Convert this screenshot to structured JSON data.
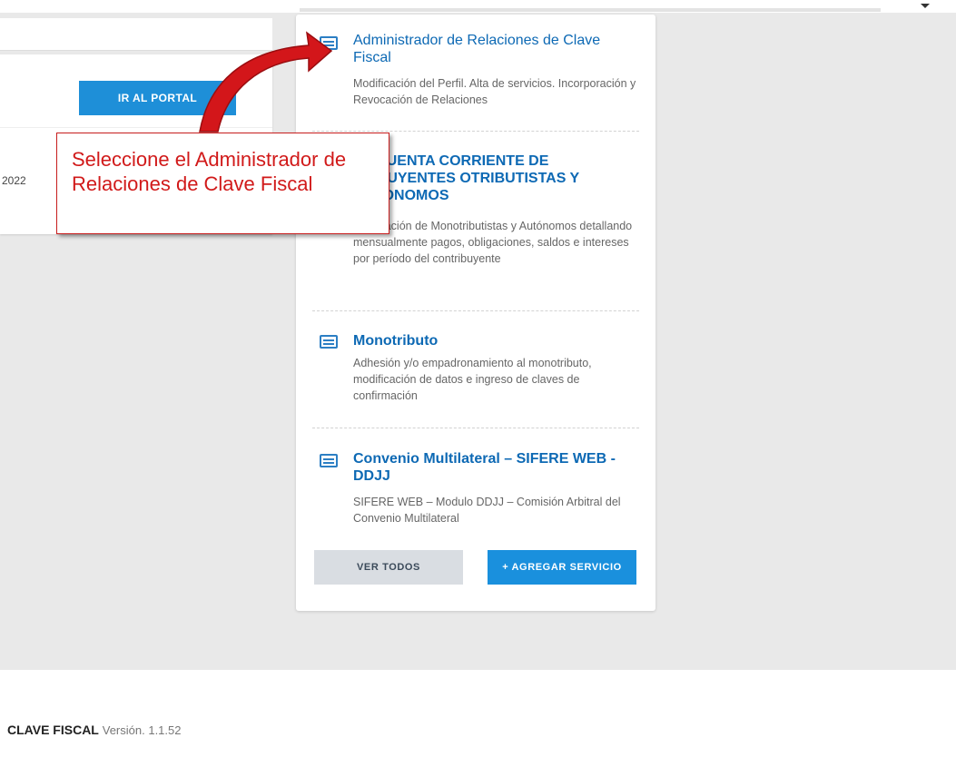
{
  "portal_button": "IR AL PORTAL",
  "left_date": "2022",
  "callout_text": "Seleccione el Administrador de Relaciones de Clave Fiscal",
  "services": [
    {
      "title": "Administrador de Relaciones de Clave Fiscal",
      "desc": "Modificación del Perfil. Alta de servicios. Incorporación y Revocación de Relaciones",
      "icon": "service-card-icon"
    },
    {
      "title": "A - CUENTA CORRIENTE DE TRIBUYENTES OTRIBUTISTAS Y AUTONOMOS",
      "desc": "información de Monotributistas y Autónomos detallando mensualmente pagos, obligaciones, saldos e intereses por período del contribuyente",
      "icon": "service-card-icon"
    },
    {
      "title": "Monotributo",
      "desc": "Adhesión y/o empadronamiento al monotributo, modificación de datos e ingreso de claves de confirmación",
      "icon": "service-card-icon"
    },
    {
      "title": "Convenio Multilateral – SIFERE WEB - DDJJ",
      "desc": "SIFERE WEB – Modulo DDJJ – Comisión Arbitral del Convenio Multilateral",
      "icon": "service-card-icon"
    }
  ],
  "buttons": {
    "ver_todos": "VER TODOS",
    "agregar": "+ AGREGAR SERVICIO"
  },
  "footer": {
    "brand": "CLAVE FISCAL",
    "version": "Versión. 1.1.52"
  },
  "colors": {
    "accent": "#1a90dd",
    "title": "#0d69b4",
    "callout": "#d11a1a"
  }
}
